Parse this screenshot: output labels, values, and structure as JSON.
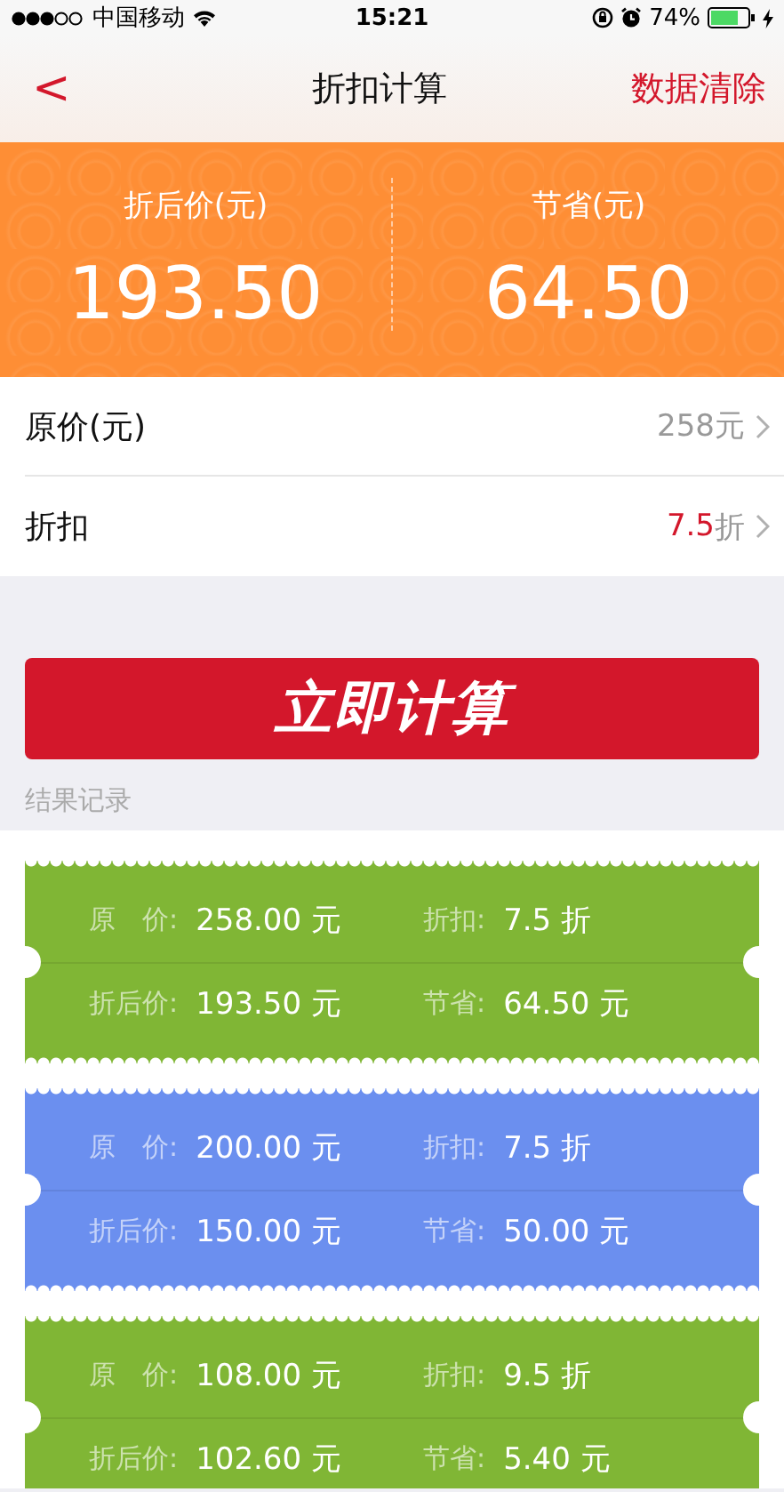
{
  "status_bar": {
    "carrier": "中国移动",
    "time": "15:21",
    "battery": "74%"
  },
  "nav": {
    "back": "<",
    "title": "折扣计算",
    "action": "数据清除"
  },
  "summary": [
    {
      "label": "折后价(元)",
      "value": "193.50"
    },
    {
      "label": "节省(元)",
      "value": "64.50"
    }
  ],
  "inputs": [
    {
      "label": "原价(元)",
      "value": "258",
      "unit": "元",
      "highlight": false
    },
    {
      "label": "折扣",
      "value": "7.5",
      "unit": "折",
      "highlight": true
    }
  ],
  "calculate_button": "立即计算",
  "records_title": "结果记录",
  "records": [
    {
      "color": "#80b635",
      "fields": [
        {
          "label": "原　价:",
          "value": "258.00 元"
        },
        {
          "label": "折扣:",
          "value": "7.5 折"
        },
        {
          "label": "折后价:",
          "value": "193.50 元"
        },
        {
          "label": "节省:",
          "value": "64.50 元"
        }
      ]
    },
    {
      "color": "#6b8fef",
      "fields": [
        {
          "label": "原　价:",
          "value": "200.00 元"
        },
        {
          "label": "折扣:",
          "value": "7.5 折"
        },
        {
          "label": "折后价:",
          "value": "150.00 元"
        },
        {
          "label": "节省:",
          "value": "50.00 元"
        }
      ]
    },
    {
      "color": "#80b635",
      "fields": [
        {
          "label": "原　价:",
          "value": "108.00 元"
        },
        {
          "label": "折扣:",
          "value": "9.5 折"
        },
        {
          "label": "折后价:",
          "value": "102.60 元"
        },
        {
          "label": "节省:",
          "value": "5.40 元"
        }
      ]
    }
  ]
}
